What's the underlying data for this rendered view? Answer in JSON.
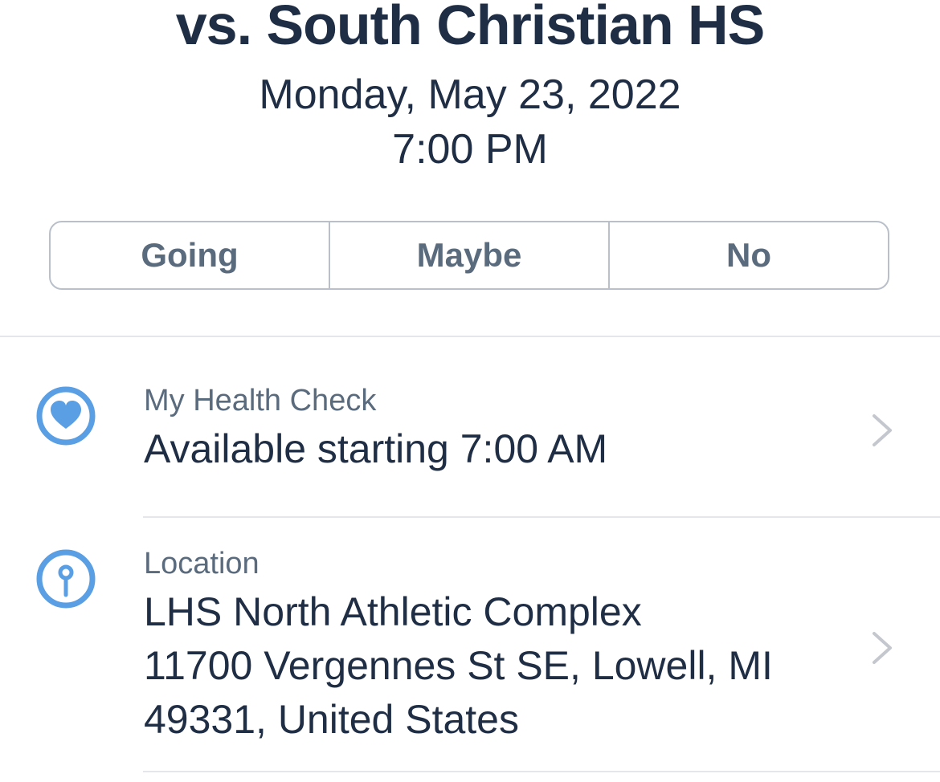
{
  "event": {
    "title": "vs. South Christian HS",
    "date": "Monday, May 23, 2022",
    "time": "7:00 PM"
  },
  "rsvp": {
    "going_label": "Going",
    "maybe_label": "Maybe",
    "no_label": "No"
  },
  "health_check": {
    "icon": "heart-icon",
    "label": "My Health Check",
    "value": "Available starting 7:00 AM"
  },
  "location": {
    "icon": "location-pin-icon",
    "label": "Location",
    "name": "LHS North Athletic Complex",
    "address_line1": "11700 Vergennes St SE, Lowell, MI",
    "address_line2": "49331, United States"
  },
  "colors": {
    "title_text": "#1f2e44",
    "secondary_text": "#5b6b7e",
    "accent": "#5a9fe3",
    "border": "#b9c0c9",
    "divider": "#e3e6ea",
    "chevron": "#c4c8ce"
  }
}
